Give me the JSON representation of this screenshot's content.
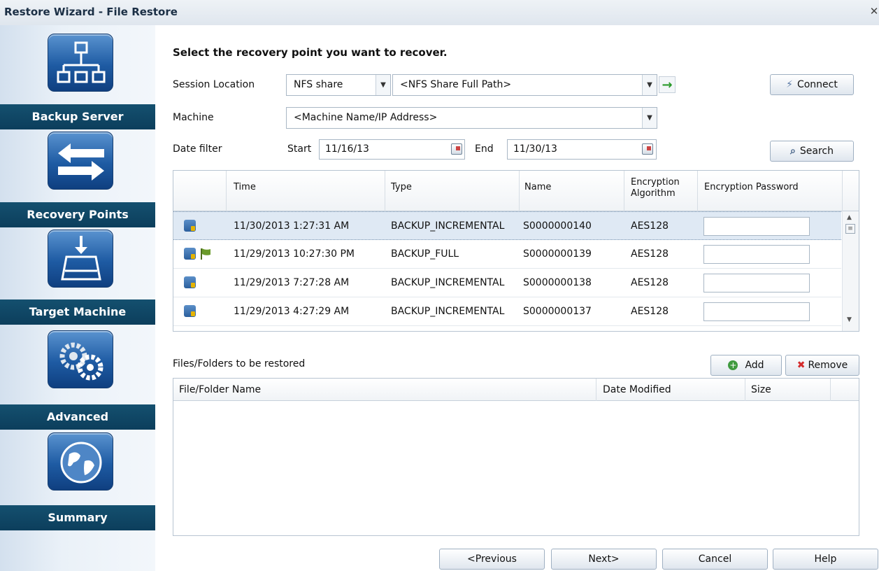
{
  "window": {
    "title": "Restore Wizard - File Restore",
    "close_glyph": "✕"
  },
  "sidebar": {
    "items": [
      {
        "label": "Backup Server",
        "icon": "network-icon"
      },
      {
        "label": "Recovery Points",
        "icon": "exchange-arrows-icon"
      },
      {
        "label": "Target Machine",
        "icon": "drive-download-icon"
      },
      {
        "label": "Advanced",
        "icon": "gears-icon"
      },
      {
        "label": "Summary",
        "icon": "globe-icon"
      }
    ]
  },
  "main": {
    "heading": "Select the recovery point you want to recover.",
    "session_location": {
      "label": "Session Location",
      "type_value": "NFS share",
      "path_value": "<NFS Share Full Path>",
      "go_glyph": "→",
      "connect_label": "Connect"
    },
    "machine": {
      "label": "Machine",
      "value": "<Machine Name/IP Address>"
    },
    "date_filter": {
      "label": "Date filter",
      "start_label": "Start",
      "start_value": "11/16/13",
      "end_label": "End",
      "end_value": "11/30/13",
      "search_label": "Search"
    },
    "recovery_points": {
      "columns": [
        "Time",
        "Type",
        "Name",
        "Encryption Algorithm",
        "Encryption Password"
      ],
      "rows": [
        {
          "time": "11/30/2013 1:27:31 AM",
          "type": "BACKUP_INCREMENTAL",
          "name": "S0000000140",
          "algo": "AES128",
          "flag": false,
          "selected": true
        },
        {
          "time": "11/29/2013 10:27:30 PM",
          "type": "BACKUP_FULL",
          "name": "S0000000139",
          "algo": "AES128",
          "flag": true,
          "selected": false
        },
        {
          "time": "11/29/2013 7:27:28 AM",
          "type": "BACKUP_INCREMENTAL",
          "name": "S0000000138",
          "algo": "AES128",
          "flag": false,
          "selected": false
        },
        {
          "time": "11/29/2013 4:27:29 AM",
          "type": "BACKUP_INCREMENTAL",
          "name": "S0000000137",
          "algo": "AES128",
          "flag": false,
          "selected": false
        }
      ]
    },
    "files": {
      "label": "Files/Folders to be restored",
      "add_label": "Add",
      "remove_label": "Remove",
      "columns": [
        "File/Folder Name",
        "Date Modified",
        "Size"
      ]
    },
    "footer": {
      "previous_label": "<Previous",
      "next_label": "Next>",
      "cancel_label": "Cancel",
      "help_label": "Help"
    }
  }
}
